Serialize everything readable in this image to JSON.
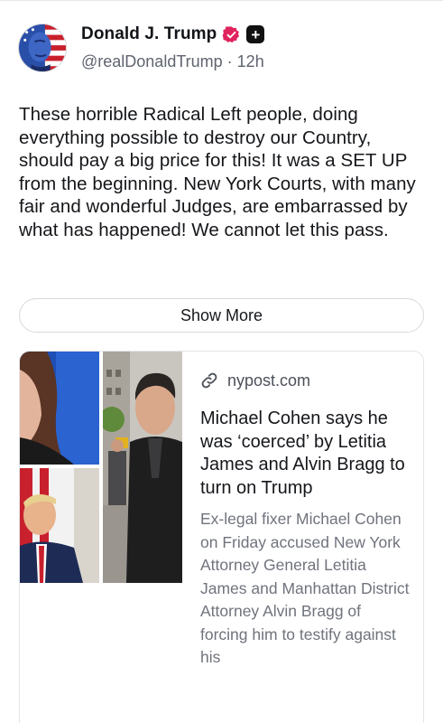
{
  "author": {
    "display_name": "Donald J. Trump",
    "handle": "@realDonaldTrump",
    "separator": "·",
    "time_ago": "12h",
    "verified_color": "#e0245e",
    "plus_badge_icon": "plus"
  },
  "post": {
    "text": "These horrible Radical Left people, doing everything possible to destroy our Country, should pay a big price for this! It was a SET UP from the beginning. New York Courts, with many fair and wonderful Judges, are embarrassed by what has happened! We cannot let this pass.",
    "show_more_label": "Show More"
  },
  "link_preview": {
    "domain": "nypost.com",
    "headline": "Michael Cohen says he was ‘coerced’ by Letitia James and Alvin Bragg to turn on Trump",
    "summary": "Ex-legal fixer Michael Cohen on Friday accused New York Attorney General Letitia James and Manhattan District Attorney Alvin Bragg of forcing him to testify against his"
  },
  "colors": {
    "text_primary": "#111418",
    "text_secondary": "#5f6470",
    "border": "#e4e5e9"
  }
}
